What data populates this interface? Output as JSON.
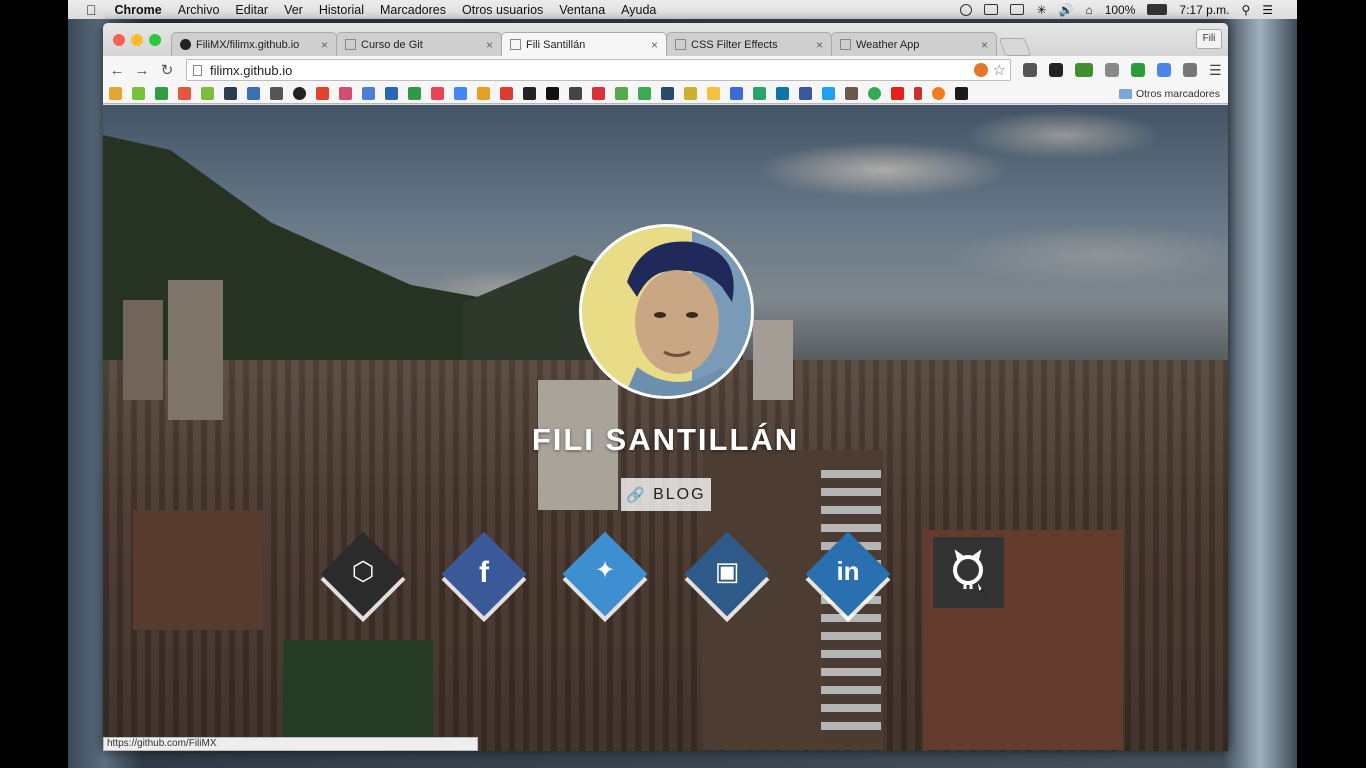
{
  "menubar": {
    "app": "Chrome",
    "items": [
      "Archivo",
      "Editar",
      "Ver",
      "Historial",
      "Marcadores",
      "Otros usuarios",
      "Ventana",
      "Ayuda"
    ],
    "battery": "100%",
    "time": "7:17 p.m."
  },
  "browser": {
    "tabs": [
      {
        "title": "FiliMX/filimx.github.io",
        "active": false
      },
      {
        "title": "Curso de Git",
        "active": false
      },
      {
        "title": "Fili Santillán",
        "active": true
      },
      {
        "title": "CSS Filter Effects",
        "active": false
      },
      {
        "title": "Weather App",
        "active": false
      }
    ],
    "profile": "Fili",
    "url": "filimx.github.io",
    "bookmarks_folder": "Otros marcadores",
    "status_url": "https://github.com/FiliMX"
  },
  "page": {
    "name": "FILI SANTILLÁN",
    "blog_label": "BLOG",
    "social": [
      {
        "name": "codepen",
        "color": "#2b2b2b"
      },
      {
        "name": "facebook",
        "color": "#3b5998"
      },
      {
        "name": "twitter",
        "color": "#3d8fd1"
      },
      {
        "name": "instagram",
        "color": "#2f5b8a"
      },
      {
        "name": "linkedin",
        "color": "#2a6fb0"
      },
      {
        "name": "github",
        "color": "#333333"
      }
    ]
  }
}
